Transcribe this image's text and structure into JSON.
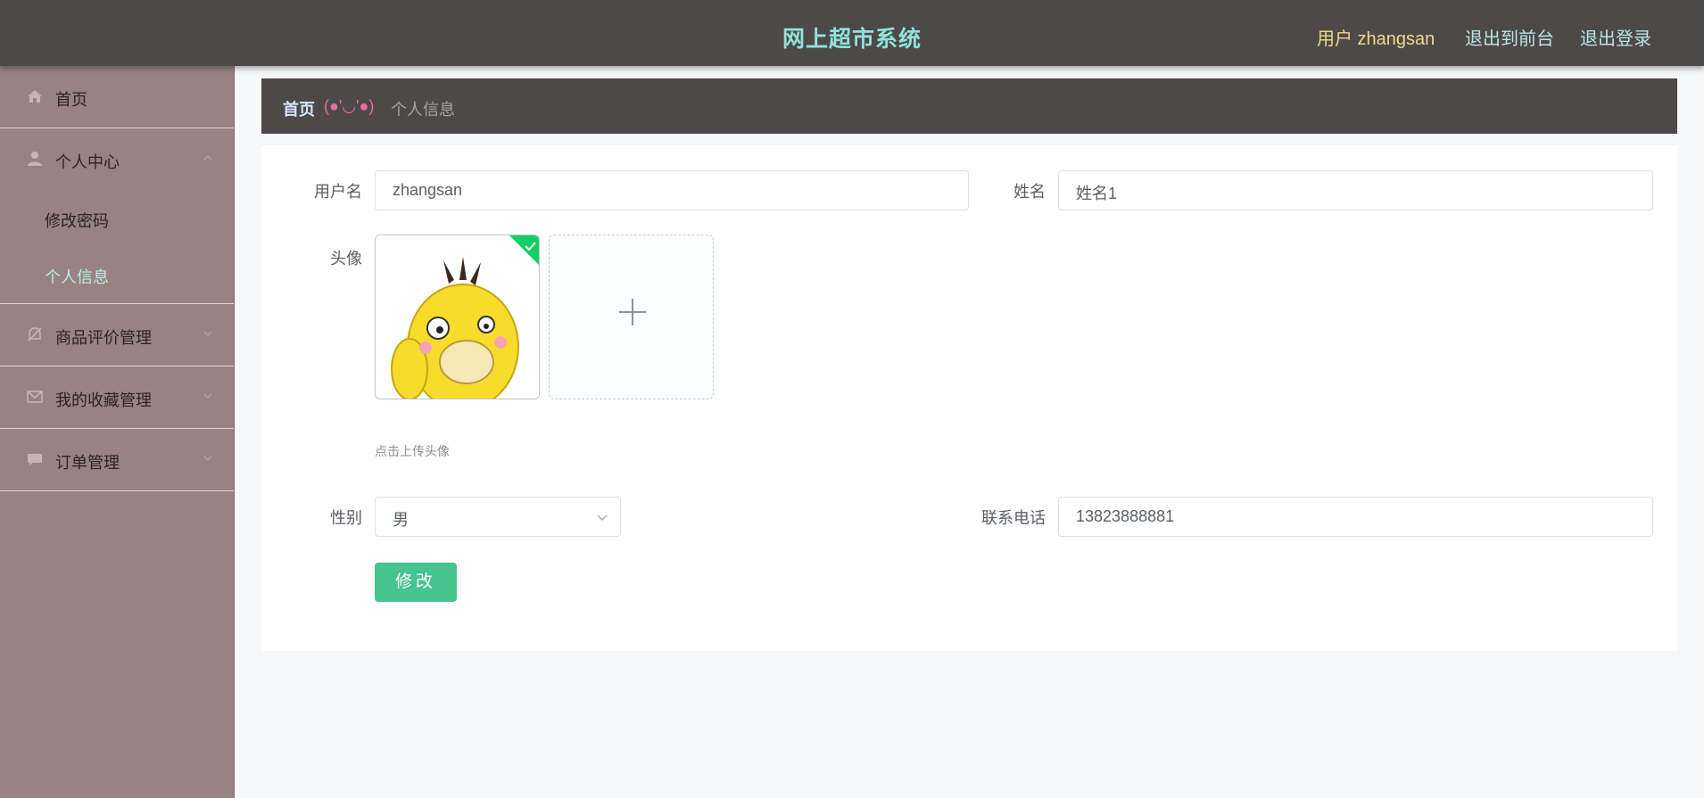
{
  "header": {
    "title": "网上超市系统",
    "user_label": "用户 zhangsan",
    "to_front": "退出到前台",
    "logout": "退出登录"
  },
  "sidebar": {
    "items": [
      {
        "label": "首页",
        "icon": "home-icon"
      },
      {
        "label": "个人中心",
        "icon": "user-icon",
        "expanded": true,
        "children": [
          {
            "label": "修改密码"
          },
          {
            "label": "个人信息",
            "active": true
          }
        ]
      },
      {
        "label": "商品评价管理",
        "icon": "bell-icon"
      },
      {
        "label": "我的收藏管理",
        "icon": "mail-icon"
      },
      {
        "label": "订单管理",
        "icon": "chat-icon"
      }
    ]
  },
  "breadcrumb": {
    "home": "首页",
    "separator": "(●'◡'●)",
    "current": "个人信息"
  },
  "form": {
    "username_label": "用户名",
    "username_value": "zhangsan",
    "name_label": "姓名",
    "name_value": "姓名1",
    "avatar_label": "头像",
    "avatar_hint": "点击上传头像",
    "gender_label": "性别",
    "gender_value": "男",
    "phone_label": "联系电话",
    "phone_value": "13823888881",
    "submit_label": "修改"
  },
  "colors": {
    "header_bg": "#4d4948",
    "sidebar_bg": "#9a8282",
    "title_color": "#8fe3dc",
    "accent_green": "#47c38e",
    "active_menu": "#b8ecea"
  }
}
